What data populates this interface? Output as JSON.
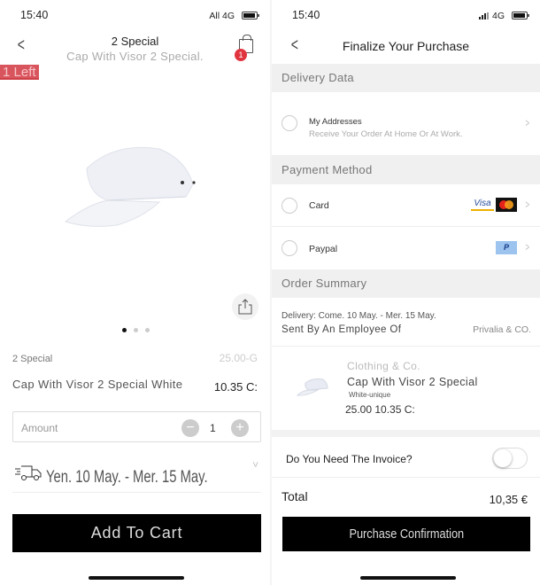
{
  "product_screen": {
    "status_bar": {
      "time": "15:40",
      "network": "All 4G"
    },
    "header": {
      "title": "2 Special",
      "subtitle": "Cap With Visor 2 Special.",
      "cart_badge": "1"
    },
    "stock_tag": "1 Left",
    "carousel": {
      "total_dots": 3,
      "active_index": 0
    },
    "brand": "2 Special",
    "original_price": "25.00-G",
    "product_name": "Cap With Visor 2 Special White",
    "price": "10.35 C:",
    "quantity": {
      "label": "Amount",
      "value": "1",
      "minus": "−",
      "plus": "+"
    },
    "delivery_estimate": "Yen. 10 May. - Mer. 15 May.",
    "add_to_cart_label": "Add To Cart"
  },
  "checkout_screen": {
    "status_bar": {
      "time": "15:40",
      "network": "4G"
    },
    "header": {
      "title": "Finalize Your Purchase"
    },
    "delivery_section": {
      "title": "Delivery Data",
      "address_title": "My Addresses",
      "address_subtitle": "Receive Your Order At Home Or At Work."
    },
    "payment_section": {
      "title": "Payment Method",
      "options": [
        {
          "label": "Card",
          "logos": [
            "Visa",
            "Mastercard"
          ]
        },
        {
          "label": "Paypal",
          "logos": [
            "PayPal"
          ]
        }
      ],
      "visa_text": "Visa",
      "paypal_text": "P"
    },
    "order_summary": {
      "title": "Order Summary",
      "delivery_line": "Delivery: Come. 10 May. - Mer. 15 May.",
      "sent_by": "Sent By An Employee Of",
      "seller": "Privalia & CO.",
      "item": {
        "brand": "Clothing & Co.",
        "name": "Cap With Visor 2 Special",
        "variant": "White-unique",
        "price": "25.00 10.35 C:"
      }
    },
    "invoice": {
      "label": "Do You Need The Invoice?",
      "enabled": false
    },
    "total": {
      "label": "Total",
      "value": "10,35 €"
    },
    "confirm_label": "Purchase Confirmation"
  }
}
